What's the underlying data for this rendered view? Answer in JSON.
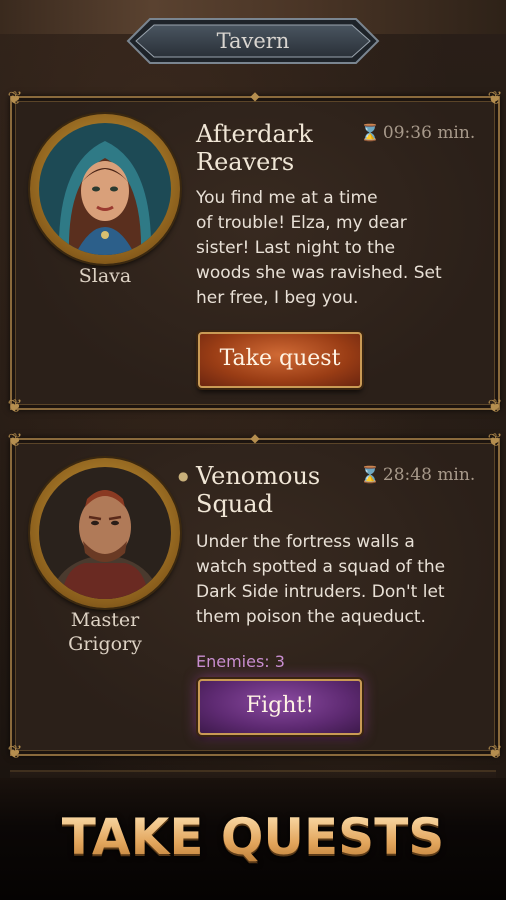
{
  "header": {
    "title": "Tavern"
  },
  "quests": [
    {
      "npc_name": "Slava",
      "title_line1": "Afterdark",
      "title_line2": "Reavers",
      "timer": "09:36 min.",
      "description_lines": [
        "You find me at a time",
        "of trouble! Elza, my dear",
        "sister! Last night to the",
        "woods she was ravished. Set",
        "her free, I beg you."
      ],
      "button_label": "Take quest"
    },
    {
      "npc_name_line1": "Master",
      "npc_name_line2": "Grigory",
      "title_line1": "Venomous",
      "title_line2": "Squad",
      "timer": "28:48 min.",
      "description_lines": [
        "Under the fortress walls a",
        "watch spotted a squad of the",
        "Dark Side intruders. Don't let",
        "them poison the aqueduct."
      ],
      "enemies": "Enemies: 3",
      "button_label": "Fight!"
    }
  ],
  "banner": {
    "text": "TAKE QUESTS"
  },
  "colors": {
    "take_quest_button": "#9a3d15",
    "fight_button": "#5e2a72",
    "enemies_text": "#c98ed0",
    "frame_gold": "#8a6a3c"
  },
  "icons": {
    "timer": "hourglass-icon",
    "difficulty": "skull-icon"
  }
}
